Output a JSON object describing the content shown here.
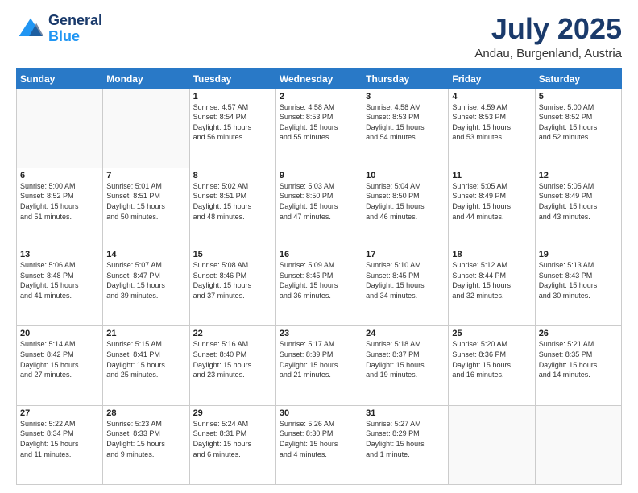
{
  "header": {
    "logo_line1": "General",
    "logo_line2": "Blue",
    "title": "July 2025",
    "subtitle": "Andau, Burgenland, Austria"
  },
  "days_of_week": [
    "Sunday",
    "Monday",
    "Tuesday",
    "Wednesday",
    "Thursday",
    "Friday",
    "Saturday"
  ],
  "weeks": [
    [
      {
        "day": "",
        "info": ""
      },
      {
        "day": "",
        "info": ""
      },
      {
        "day": "1",
        "info": "Sunrise: 4:57 AM\nSunset: 8:54 PM\nDaylight: 15 hours\nand 56 minutes."
      },
      {
        "day": "2",
        "info": "Sunrise: 4:58 AM\nSunset: 8:53 PM\nDaylight: 15 hours\nand 55 minutes."
      },
      {
        "day": "3",
        "info": "Sunrise: 4:58 AM\nSunset: 8:53 PM\nDaylight: 15 hours\nand 54 minutes."
      },
      {
        "day": "4",
        "info": "Sunrise: 4:59 AM\nSunset: 8:53 PM\nDaylight: 15 hours\nand 53 minutes."
      },
      {
        "day": "5",
        "info": "Sunrise: 5:00 AM\nSunset: 8:52 PM\nDaylight: 15 hours\nand 52 minutes."
      }
    ],
    [
      {
        "day": "6",
        "info": "Sunrise: 5:00 AM\nSunset: 8:52 PM\nDaylight: 15 hours\nand 51 minutes."
      },
      {
        "day": "7",
        "info": "Sunrise: 5:01 AM\nSunset: 8:51 PM\nDaylight: 15 hours\nand 50 minutes."
      },
      {
        "day": "8",
        "info": "Sunrise: 5:02 AM\nSunset: 8:51 PM\nDaylight: 15 hours\nand 48 minutes."
      },
      {
        "day": "9",
        "info": "Sunrise: 5:03 AM\nSunset: 8:50 PM\nDaylight: 15 hours\nand 47 minutes."
      },
      {
        "day": "10",
        "info": "Sunrise: 5:04 AM\nSunset: 8:50 PM\nDaylight: 15 hours\nand 46 minutes."
      },
      {
        "day": "11",
        "info": "Sunrise: 5:05 AM\nSunset: 8:49 PM\nDaylight: 15 hours\nand 44 minutes."
      },
      {
        "day": "12",
        "info": "Sunrise: 5:05 AM\nSunset: 8:49 PM\nDaylight: 15 hours\nand 43 minutes."
      }
    ],
    [
      {
        "day": "13",
        "info": "Sunrise: 5:06 AM\nSunset: 8:48 PM\nDaylight: 15 hours\nand 41 minutes."
      },
      {
        "day": "14",
        "info": "Sunrise: 5:07 AM\nSunset: 8:47 PM\nDaylight: 15 hours\nand 39 minutes."
      },
      {
        "day": "15",
        "info": "Sunrise: 5:08 AM\nSunset: 8:46 PM\nDaylight: 15 hours\nand 37 minutes."
      },
      {
        "day": "16",
        "info": "Sunrise: 5:09 AM\nSunset: 8:45 PM\nDaylight: 15 hours\nand 36 minutes."
      },
      {
        "day": "17",
        "info": "Sunrise: 5:10 AM\nSunset: 8:45 PM\nDaylight: 15 hours\nand 34 minutes."
      },
      {
        "day": "18",
        "info": "Sunrise: 5:12 AM\nSunset: 8:44 PM\nDaylight: 15 hours\nand 32 minutes."
      },
      {
        "day": "19",
        "info": "Sunrise: 5:13 AM\nSunset: 8:43 PM\nDaylight: 15 hours\nand 30 minutes."
      }
    ],
    [
      {
        "day": "20",
        "info": "Sunrise: 5:14 AM\nSunset: 8:42 PM\nDaylight: 15 hours\nand 27 minutes."
      },
      {
        "day": "21",
        "info": "Sunrise: 5:15 AM\nSunset: 8:41 PM\nDaylight: 15 hours\nand 25 minutes."
      },
      {
        "day": "22",
        "info": "Sunrise: 5:16 AM\nSunset: 8:40 PM\nDaylight: 15 hours\nand 23 minutes."
      },
      {
        "day": "23",
        "info": "Sunrise: 5:17 AM\nSunset: 8:39 PM\nDaylight: 15 hours\nand 21 minutes."
      },
      {
        "day": "24",
        "info": "Sunrise: 5:18 AM\nSunset: 8:37 PM\nDaylight: 15 hours\nand 19 minutes."
      },
      {
        "day": "25",
        "info": "Sunrise: 5:20 AM\nSunset: 8:36 PM\nDaylight: 15 hours\nand 16 minutes."
      },
      {
        "day": "26",
        "info": "Sunrise: 5:21 AM\nSunset: 8:35 PM\nDaylight: 15 hours\nand 14 minutes."
      }
    ],
    [
      {
        "day": "27",
        "info": "Sunrise: 5:22 AM\nSunset: 8:34 PM\nDaylight: 15 hours\nand 11 minutes."
      },
      {
        "day": "28",
        "info": "Sunrise: 5:23 AM\nSunset: 8:33 PM\nDaylight: 15 hours\nand 9 minutes."
      },
      {
        "day": "29",
        "info": "Sunrise: 5:24 AM\nSunset: 8:31 PM\nDaylight: 15 hours\nand 6 minutes."
      },
      {
        "day": "30",
        "info": "Sunrise: 5:26 AM\nSunset: 8:30 PM\nDaylight: 15 hours\nand 4 minutes."
      },
      {
        "day": "31",
        "info": "Sunrise: 5:27 AM\nSunset: 8:29 PM\nDaylight: 15 hours\nand 1 minute."
      },
      {
        "day": "",
        "info": ""
      },
      {
        "day": "",
        "info": ""
      }
    ]
  ]
}
